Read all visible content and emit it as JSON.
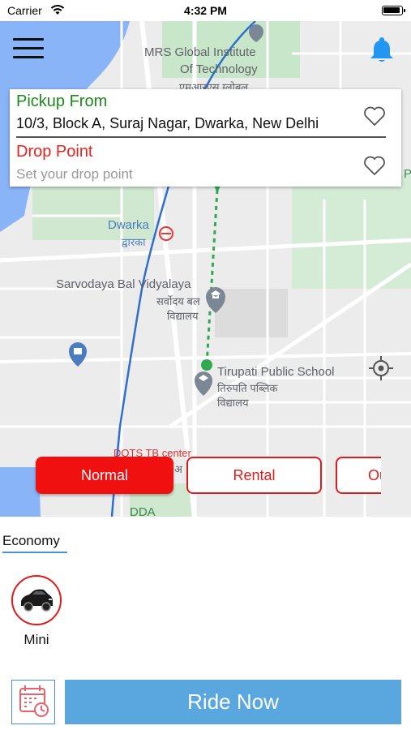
{
  "status_bar": {
    "carrier": "Carrier",
    "time": "4:32 PM"
  },
  "map": {
    "labels": {
      "institute_line1": "MRS Global Institute",
      "institute_line2": "Of Technology",
      "institute_hindi": "एमआरएस ग्लोबल",
      "dwarka": "Dwarka",
      "dwarka_hindi": "द्वारका",
      "school1": "Sarvodaya Bal Vidyalaya",
      "school1_hindi1": "सर्वोदय बल",
      "school1_hindi2": "विद्यालय",
      "school2": "Tirupati Public School",
      "school2_hindi1": "तिरुपति पब्लिक",
      "school2_hindi2": "विद्यालय",
      "dots": "DOTS TB center",
      "dots_hindi": "अ",
      "dda": "DDA",
      "edge_p": "P"
    },
    "menu_icon": "hamburger-icon",
    "bell_icon": "bell-icon",
    "locate_icon": "crosshair-icon"
  },
  "address_card": {
    "pickup_label": "Pickup From",
    "pickup_address": "10/3, Block A, Suraj Nagar, Dwarka, New Delhi",
    "drop_label": "Drop Point",
    "drop_placeholder": "Set your drop point",
    "drop_value": ""
  },
  "ride_tabs": [
    {
      "label": "Normal",
      "active": true
    },
    {
      "label": "Rental",
      "active": false
    },
    {
      "label": "Outstation",
      "active": false
    }
  ],
  "categories": {
    "selected": "Economy"
  },
  "vehicles": [
    {
      "name": "Mini",
      "icon": "car-icon",
      "selected": true
    }
  ],
  "actions": {
    "schedule_icon": "calendar-clock-icon",
    "ride_now": "Ride Now"
  },
  "colors": {
    "pickup_green": "#1a8a1a",
    "drop_red": "#e52222",
    "tab_active": "#f01010",
    "ride_now_blue": "#5aa7df",
    "underline_blue": "#4a90d9"
  }
}
